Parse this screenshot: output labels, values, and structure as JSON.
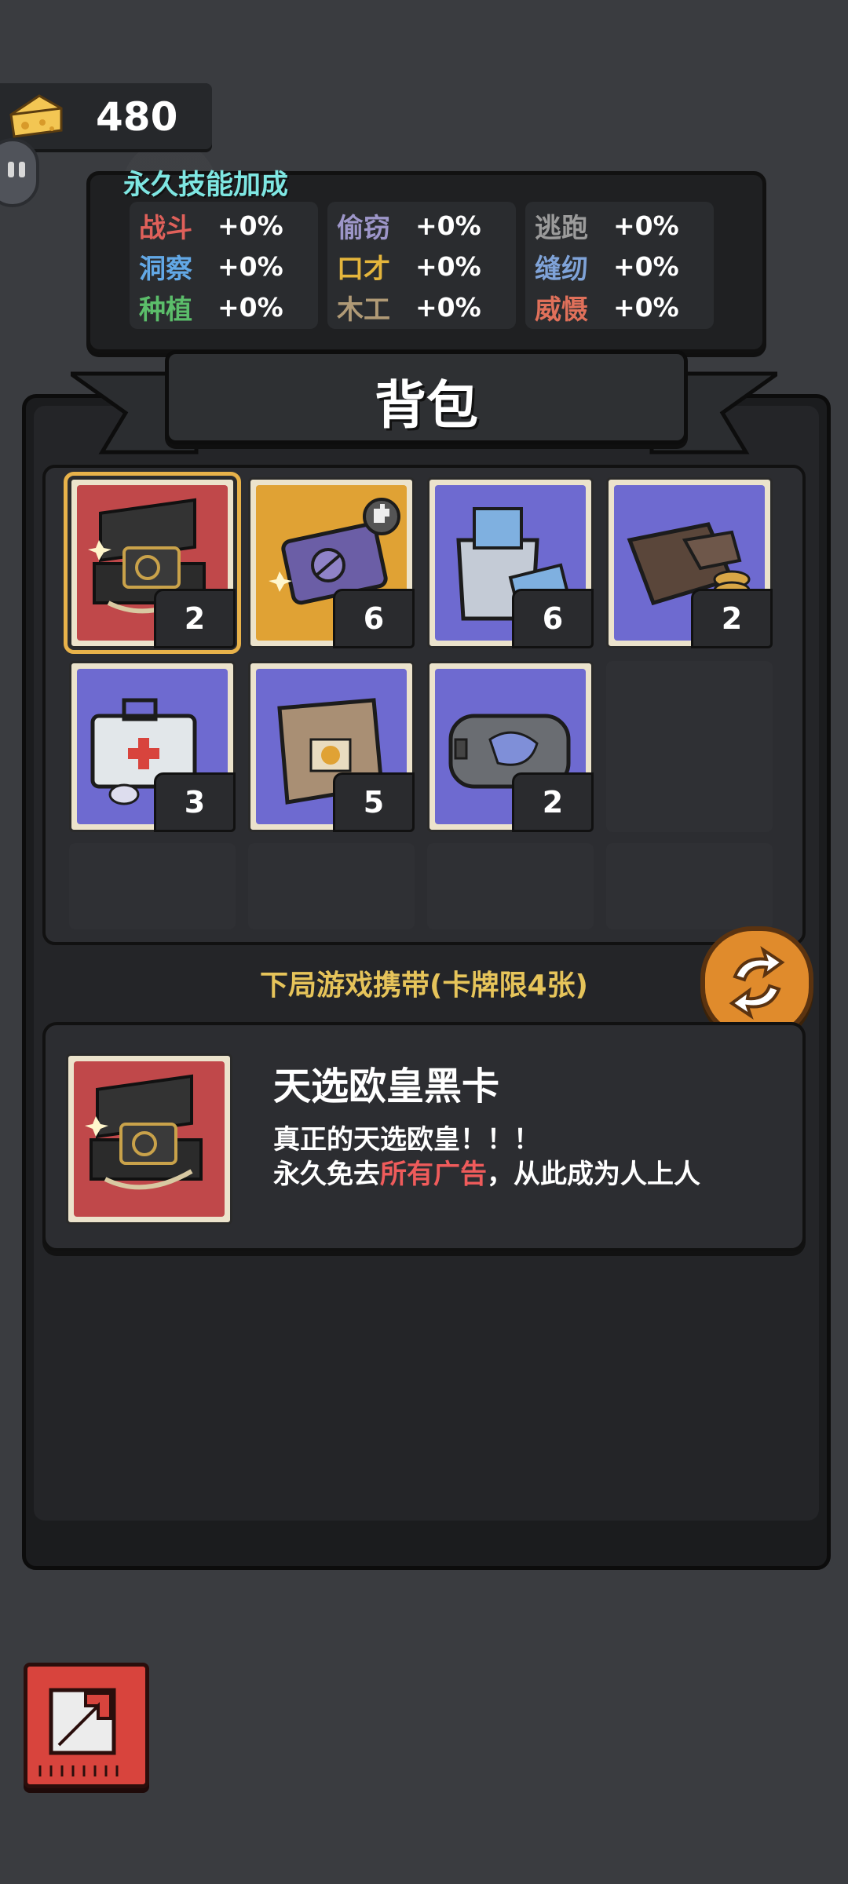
{
  "currency": {
    "value": "480",
    "icon": "cheese-icon"
  },
  "skills": {
    "title": "永久技能加成",
    "columns": [
      [
        {
          "name": "战斗",
          "value": "+0%",
          "color": "#e0605a"
        },
        {
          "name": "洞察",
          "value": "+0%",
          "color": "#62a8e6"
        },
        {
          "name": "种植",
          "value": "+0%",
          "color": "#5bbd6a"
        }
      ],
      [
        {
          "name": "偷窃",
          "value": "+0%",
          "color": "#9d96c9"
        },
        {
          "name": "口才",
          "value": "+0%",
          "color": "#e4b53c"
        },
        {
          "name": "木工",
          "value": "+0%",
          "color": "#b09a76"
        }
      ],
      [
        {
          "name": "逃跑",
          "value": "+0%",
          "color": "#9b9b9b"
        },
        {
          "name": "缝纫",
          "value": "+0%",
          "color": "#7fa3d8"
        },
        {
          "name": "威慑",
          "value": "+0%",
          "color": "#e0705a"
        }
      ]
    ]
  },
  "backpack": {
    "title": "背包"
  },
  "items": [
    {
      "id": "black-card",
      "count": "2",
      "bg": "#c0484a",
      "selected": true
    },
    {
      "id": "purple-card",
      "count": "6",
      "bg": "#e0a234"
    },
    {
      "id": "cash-bag",
      "count": "6",
      "bg": "#6e6ad0"
    },
    {
      "id": "wallet",
      "count": "2",
      "bg": "#6e6ad0"
    },
    {
      "id": "first-aid-kit",
      "count": "3",
      "bg": "#6e6ad0"
    },
    {
      "id": "paper-bag",
      "count": "5",
      "bg": "#6e6ad0"
    },
    {
      "id": "toiletry-bag",
      "count": "2",
      "bg": "#6e6ad0"
    }
  ],
  "carry": {
    "label": "下局游戏携带(卡牌限4张)"
  },
  "detail": {
    "title": "天选欧皇黑卡",
    "desc_line1": "真正的天选欧皇！！！",
    "desc_line2_pre": "永久免去",
    "desc_line2_hl": "所有广告",
    "desc_line2_post": "，从此成为人上人"
  },
  "colors": {
    "accent_gold": "#e8b24a",
    "carry_label": "#e6c45a",
    "highlight_red": "#ef5b5b"
  }
}
